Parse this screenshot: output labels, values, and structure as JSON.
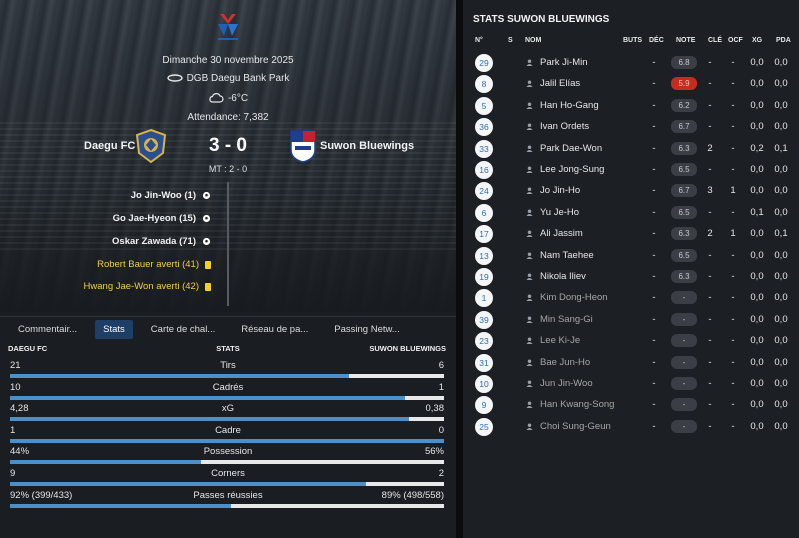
{
  "match": {
    "date": "Dimanche 30 novembre 2025",
    "venue": "DGB Daegu Bank Park",
    "temperature": "-6°C",
    "attendance": "Attendance: 7,382",
    "home_team": "Daegu FC",
    "away_team": "Suwon Bluewings",
    "score": "3 - 0",
    "halftime": "MT : 2 - 0"
  },
  "events": [
    {
      "text": "Jo Jin-Woo (1)",
      "icon": "ball-icon"
    },
    {
      "text": "Go Jae-Hyeon (15)",
      "icon": "ball-icon"
    },
    {
      "text": "Oskar Zawada (71)",
      "icon": "ball-icon"
    },
    {
      "text": "Robert Bauer averti (41)",
      "icon": "yellow-card-icon"
    },
    {
      "text": "Hwang Jae-Won averti (42)",
      "icon": "yellow-card-icon"
    }
  ],
  "tabs": [
    "Commentair...",
    "Stats",
    "Carte de chal...",
    "Réseau de pa...",
    "Passing Netw..."
  ],
  "active_tab": 1,
  "stats_header": {
    "home": "DAEGU FC",
    "mid": "STATS",
    "away": "SUWON BLUEWINGS"
  },
  "stats": [
    {
      "label": "Tirs",
      "home": "21",
      "away": "6",
      "home_share": 0.78
    },
    {
      "label": "Cadrés",
      "home": "10",
      "away": "1",
      "home_share": 0.91
    },
    {
      "label": "xG",
      "home": "4,28",
      "away": "0,38",
      "home_share": 0.92
    },
    {
      "label": "Cadre",
      "home": "1",
      "away": "0",
      "home_share": 1.0
    },
    {
      "label": "Possession",
      "home": "44%",
      "away": "56%",
      "home_share": 0.44
    },
    {
      "label": "Corners",
      "home": "9",
      "away": "2",
      "home_share": 0.82
    },
    {
      "label": "Passes réussies",
      "home": "92% (399/433)",
      "away": "89% (498/558)",
      "home_share": 0.51
    }
  ],
  "right": {
    "title": "STATS SUWON BLUEWINGS",
    "columns": [
      "N°",
      "S",
      "NOM",
      "BUTS",
      "DÉC",
      "NOTE",
      "CLÉ",
      "OCF",
      "XG",
      "PDA"
    ],
    "players": [
      {
        "num": "29",
        "name": "Park Ji-Min",
        "buts": "",
        "dec": "-",
        "note": "6.8",
        "cle": "-",
        "ocf": "-",
        "xg": "0,0",
        "pda": "0,0",
        "sub": false,
        "bad": false
      },
      {
        "num": "8",
        "name": "Jalil Elías",
        "buts": "",
        "dec": "-",
        "note": "5.9",
        "cle": "-",
        "ocf": "-",
        "xg": "0,0",
        "pda": "0,0",
        "sub": false,
        "bad": true
      },
      {
        "num": "5",
        "name": "Han Ho-Gang",
        "buts": "",
        "dec": "-",
        "note": "6.2",
        "cle": "-",
        "ocf": "-",
        "xg": "0,0",
        "pda": "0,0",
        "sub": false,
        "bad": false
      },
      {
        "num": "36",
        "name": "Ivan Ordets",
        "buts": "",
        "dec": "-",
        "note": "6.7",
        "cle": "-",
        "ocf": "-",
        "xg": "0,0",
        "pda": "0,0",
        "sub": false,
        "bad": false
      },
      {
        "num": "33",
        "name": "Park Dae-Won",
        "buts": "",
        "dec": "-",
        "note": "6.3",
        "cle": "2",
        "ocf": "-",
        "xg": "0,2",
        "pda": "0,1",
        "sub": false,
        "bad": false
      },
      {
        "num": "16",
        "name": "Lee Jong-Sung",
        "buts": "",
        "dec": "-",
        "note": "6.5",
        "cle": "-",
        "ocf": "-",
        "xg": "0,0",
        "pda": "0,0",
        "sub": false,
        "bad": false
      },
      {
        "num": "24",
        "name": "Jo Jin-Ho",
        "buts": "",
        "dec": "-",
        "note": "6.7",
        "cle": "3",
        "ocf": "1",
        "xg": "0,0",
        "pda": "0,0",
        "sub": false,
        "bad": false
      },
      {
        "num": "6",
        "name": "Yu Je-Ho",
        "buts": "",
        "dec": "-",
        "note": "6.5",
        "cle": "-",
        "ocf": "-",
        "xg": "0,1",
        "pda": "0,0",
        "sub": false,
        "bad": false
      },
      {
        "num": "17",
        "name": "Ali Jassim",
        "buts": "",
        "dec": "-",
        "note": "6.3",
        "cle": "2",
        "ocf": "1",
        "xg": "0,0",
        "pda": "0,1",
        "sub": false,
        "bad": false
      },
      {
        "num": "13",
        "name": "Nam Taehee",
        "buts": "",
        "dec": "-",
        "note": "6.5",
        "cle": "-",
        "ocf": "-",
        "xg": "0,0",
        "pda": "0,0",
        "sub": false,
        "bad": false
      },
      {
        "num": "19",
        "name": "Nikola Iliev",
        "buts": "",
        "dec": "-",
        "note": "6.3",
        "cle": "-",
        "ocf": "-",
        "xg": "0,0",
        "pda": "0,0",
        "sub": false,
        "bad": false
      },
      {
        "num": "1",
        "name": "Kim Dong-Heon",
        "buts": "",
        "dec": "-",
        "note": "-",
        "cle": "-",
        "ocf": "-",
        "xg": "0,0",
        "pda": "0,0",
        "sub": true,
        "bad": false
      },
      {
        "num": "39",
        "name": "Min Sang-Gi",
        "buts": "",
        "dec": "-",
        "note": "-",
        "cle": "-",
        "ocf": "-",
        "xg": "0,0",
        "pda": "0,0",
        "sub": true,
        "bad": false
      },
      {
        "num": "23",
        "name": "Lee Ki-Je",
        "buts": "",
        "dec": "-",
        "note": "-",
        "cle": "-",
        "ocf": "-",
        "xg": "0,0",
        "pda": "0,0",
        "sub": true,
        "bad": false
      },
      {
        "num": "31",
        "name": "Bae Jun-Ho",
        "buts": "",
        "dec": "-",
        "note": "-",
        "cle": "-",
        "ocf": "-",
        "xg": "0,0",
        "pda": "0,0",
        "sub": true,
        "bad": false
      },
      {
        "num": "10",
        "name": "Jun Jin-Woo",
        "buts": "",
        "dec": "-",
        "note": "-",
        "cle": "-",
        "ocf": "-",
        "xg": "0,0",
        "pda": "0,0",
        "sub": true,
        "bad": false
      },
      {
        "num": "9",
        "name": "Han Kwang-Song",
        "buts": "",
        "dec": "-",
        "note": "-",
        "cle": "-",
        "ocf": "-",
        "xg": "0,0",
        "pda": "0,0",
        "sub": true,
        "bad": false
      },
      {
        "num": "25",
        "name": "Choi Sung-Geun",
        "buts": "",
        "dec": "-",
        "note": "-",
        "cle": "-",
        "ocf": "-",
        "xg": "0,0",
        "pda": "0,0",
        "sub": true,
        "bad": false
      }
    ]
  },
  "colors": {
    "bar_fill": "#4d8fc9",
    "active_tab": "#1f3e66",
    "bad_rating": "#c62b20",
    "yellow_card": "#f3d31d",
    "number_text": "#2d6db5"
  }
}
